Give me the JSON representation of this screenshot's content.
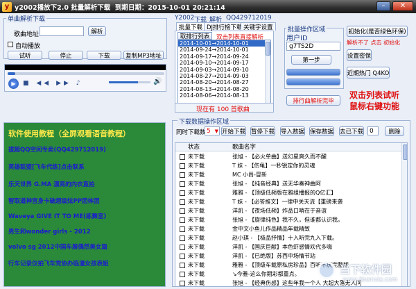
{
  "window": {
    "title": "y2002播放下2.0 批量解析下载  到期日期：2015-10-01 20:21:14",
    "app_icon": "y",
    "minimize_glyph": "–",
    "close_glyph": "✕"
  },
  "single_parse": {
    "group_title": "单曲解析下载",
    "song_address_label": "歌曲地址",
    "song_address_value": "",
    "parse_button": "解析",
    "auto_play_label": "自动播放",
    "buttons": [
      "试听",
      "停止",
      "下载",
      "复制MP3地址"
    ]
  },
  "player": {
    "progress": 0.05,
    "volume": 0.7
  },
  "top_nav": {
    "items": [
      "Y2002",
      "下载",
      "解析",
      "QQ429712019"
    ]
  },
  "tabs": [
    {
      "label": "批量下载"
    },
    {
      "label": "DJ排行榜下载"
    },
    {
      "label": "关键字设置"
    }
  ],
  "subtab": {
    "label": "取排行列表",
    "hint": "双击列表直接解析"
  },
  "tracklist": {
    "items": [
      "2014-10-01→2014-10-01",
      "2014-09-24→2014-10-01",
      "2014-09-17→2014-09-24",
      "2014-09-10→2014-09-17",
      "2014-09-03→2014-09-10",
      "2014-08-27→2014-09-03",
      "2014-08-20→2014-08-27",
      "2014-08-13→2014-08-20",
      "2014-08-06→2014-08-13"
    ],
    "selected_index": 0
  },
  "count_status": "现在有 100 首歌曲",
  "batch_ops": {
    "group_title": "批量操作区域",
    "user_id_label": "用户ID",
    "user_id_value": "g7TS2D",
    "step1_button": "第一步",
    "rank_parse_done": "排行曲解析完毕"
  },
  "init": {
    "init_button": "初始化(是否绿色环保)",
    "init_hint": "解析不了  点击 初始化",
    "set_password_button": "设置密保",
    "recent_plays_button": "近期热门 Q4KO"
  },
  "annotation": {
    "line1": "双击列表试听",
    "line2": "鼠标右键功能"
  },
  "green_panel": {
    "header": "软件使用教程（全屏观看语音教程）",
    "items": [
      "拔超QQ空间专卖(QQ429712019)",
      "英雄联盟[飞车代练]点击联系",
      "乐天世界 G.MA 漂亮的内衣直拍",
      "智取道神宫身卡破超级炫PP团体团",
      "Waveya GIVE IT TO ME(练舞室)",
      "男生和wonder girls - 2012",
      "volvo sg 2012中国车展偶然美女篇",
      "行车记录仪拍飞车党协办临潼女孩表姐"
    ]
  },
  "download_ops": {
    "group_title": "下载数据操作区域",
    "concurrent_label": "同时下载数",
    "concurrent_value": "5",
    "buttons": [
      "开始下载",
      "暂停下载",
      "导入数据",
      "保存数据",
      "去已下载"
    ],
    "count_value": "0",
    "delete_button": "删除"
  },
  "table": {
    "columns": [
      "状态",
      "歌曲名字"
    ],
    "rows": [
      {
        "status": "未下载",
        "name": "张旭 - 【必火单曲】送幻星爽久而不醒"
      },
      {
        "status": "未下载",
        "name": "T  妹  - 【伤龟】一秒锐定你的灵魂"
      },
      {
        "status": "未下载",
        "name": "MC 小尚-冒新"
      },
      {
        "status": "未下载",
        "name": "张旭 - 【纯音经典】送无华奏神曲阿"
      },
      {
        "status": "未下载",
        "name": "雅雅 - 【顶级低频版在雅组播报的Q亿汇】"
      },
      {
        "status": "未下载",
        "name": "T  妹  - 【必答推文】一律中关天流【重磅来袭"
      },
      {
        "status": "未下载",
        "name": "洋凯 - 【夜场低频】炸品口哨在于音谊"
      },
      {
        "status": "未下载",
        "name": "张旭 - 【旋律纯色】我不久，但谁都认识我。"
      },
      {
        "status": "未下载",
        "name": "金中文小鱼儿作品精品年载精致"
      },
      {
        "status": "未下载",
        "name": "赵小琪 - 【极品抒情】十入听完九入下载。"
      },
      {
        "status": "未下载",
        "name": "洋凯 - 【国庆巨献】本色虾感情欢代多嗨"
      },
      {
        "status": "未下载",
        "name": "洋凯 - 【已绝版】苏西中场情节站"
      },
      {
        "status": "未下载",
        "name": "雅雅 - 【顶级车载原私房珍品】百听不厌完整版"
      },
      {
        "status": "未下载",
        "name": "↘今雅-这么你期彩都重点。"
      },
      {
        "status": "未下载",
        "name": "张旭 - 【经典伤感】这些年我一个人 大起大落无人问"
      }
    ]
  },
  "watermark": {
    "text": "当下软件园",
    "subtext": "www.downxia.com"
  },
  "colors": {
    "accent": "#3169c6",
    "red_text": "#e01010",
    "green_panel": "#2a8a3a"
  }
}
